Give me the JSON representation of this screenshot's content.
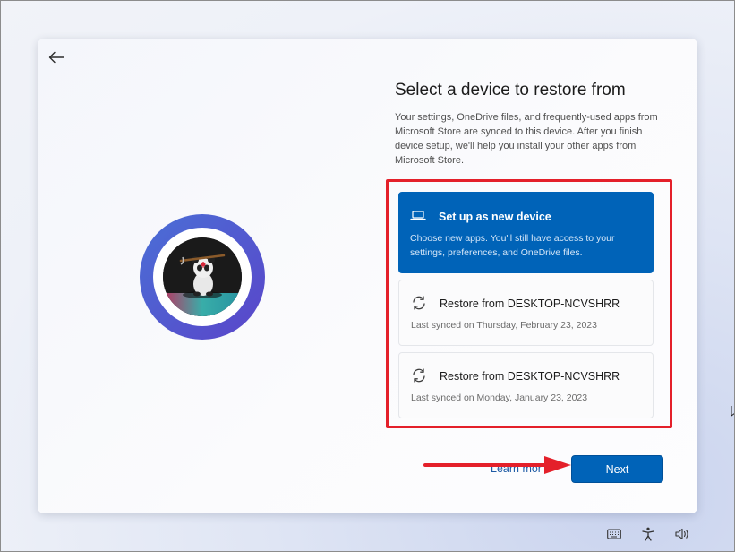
{
  "header": {
    "back_icon": "arrow-left-icon"
  },
  "page": {
    "title": "Select a device to restore from",
    "description": "Your settings, OneDrive files, and frequently-used apps from Microsoft Store are synced to this device. After you finish device setup, we'll help you install your other apps from Microsoft Store."
  },
  "options": [
    {
      "icon": "laptop-icon",
      "title": "Set up as new device",
      "subtitle": "Choose new apps. You'll still have access to your settings, preferences, and OneDrive files.",
      "selected": true
    },
    {
      "icon": "sync-icon",
      "title": "Restore from DESKTOP-NCVSHRR",
      "subtitle": "Last synced on Thursday, February 23, 2023",
      "selected": false
    },
    {
      "icon": "sync-icon",
      "title": "Restore from DESKTOP-NCVSHRR",
      "subtitle": "Last synced on Monday, January 23, 2023",
      "selected": false
    }
  ],
  "footer": {
    "learn_more": "Learn mor",
    "next_label": "Next"
  },
  "tray": {
    "icons": [
      "keyboard-icon",
      "accessibility-icon",
      "volume-icon"
    ]
  },
  "colors": {
    "accent": "#0063b8",
    "annotation_red": "#e4202a",
    "avatar_ring": "#5a45c9"
  }
}
